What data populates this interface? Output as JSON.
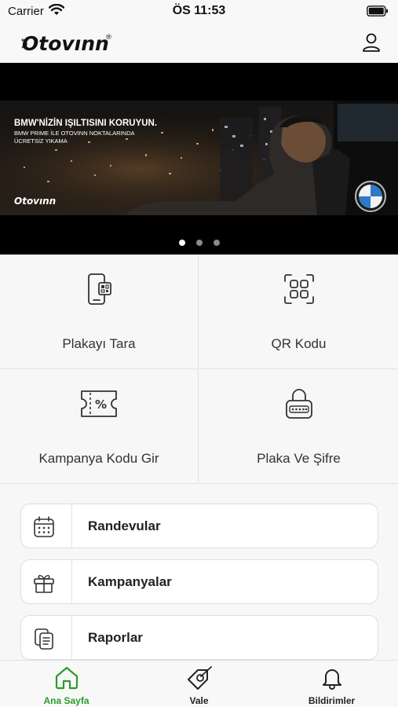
{
  "status_bar": {
    "carrier": "Carrier",
    "time": "ÖS 11:53"
  },
  "header": {
    "logo_text": "Otovınn",
    "logo_mark": "®",
    "profile_icon": "user-icon"
  },
  "banner": {
    "headline": "BMW'NİZİN IŞILTISINI KORUYUN.",
    "subline_1": "BMW PRIME İLE OTOVINN NOKTALARINDA",
    "subline_2": "ÜCRETSİZ YIKAMA",
    "watermark": "Otovınn",
    "brand_badge": "BMW",
    "slide_count": 3,
    "active_slide": 1
  },
  "actions": [
    {
      "label": "Plakayı Tara",
      "icon": "phone-scan-icon"
    },
    {
      "label": "QR Kodu",
      "icon": "qr-code-icon"
    },
    {
      "label": "Kampanya Kodu Gir",
      "icon": "coupon-icon"
    },
    {
      "label": "Plaka Ve Şifre",
      "icon": "lock-icon"
    }
  ],
  "menu": [
    {
      "label": "Randevular",
      "icon": "calendar-icon"
    },
    {
      "label": "Kampanyalar",
      "icon": "gift-icon"
    },
    {
      "label": "Raporlar",
      "icon": "reports-icon"
    }
  ],
  "tabs": [
    {
      "label": "Ana Sayfa",
      "icon": "home-icon",
      "active": true
    },
    {
      "label": "Vale",
      "icon": "vale-tag-icon",
      "active": false
    },
    {
      "label": "Bildirimler",
      "icon": "bell-icon",
      "active": false
    }
  ],
  "colors": {
    "accent": "#2a9c2a",
    "banner_bg": "#000000",
    "grid_bg": "#f7f7f7"
  }
}
